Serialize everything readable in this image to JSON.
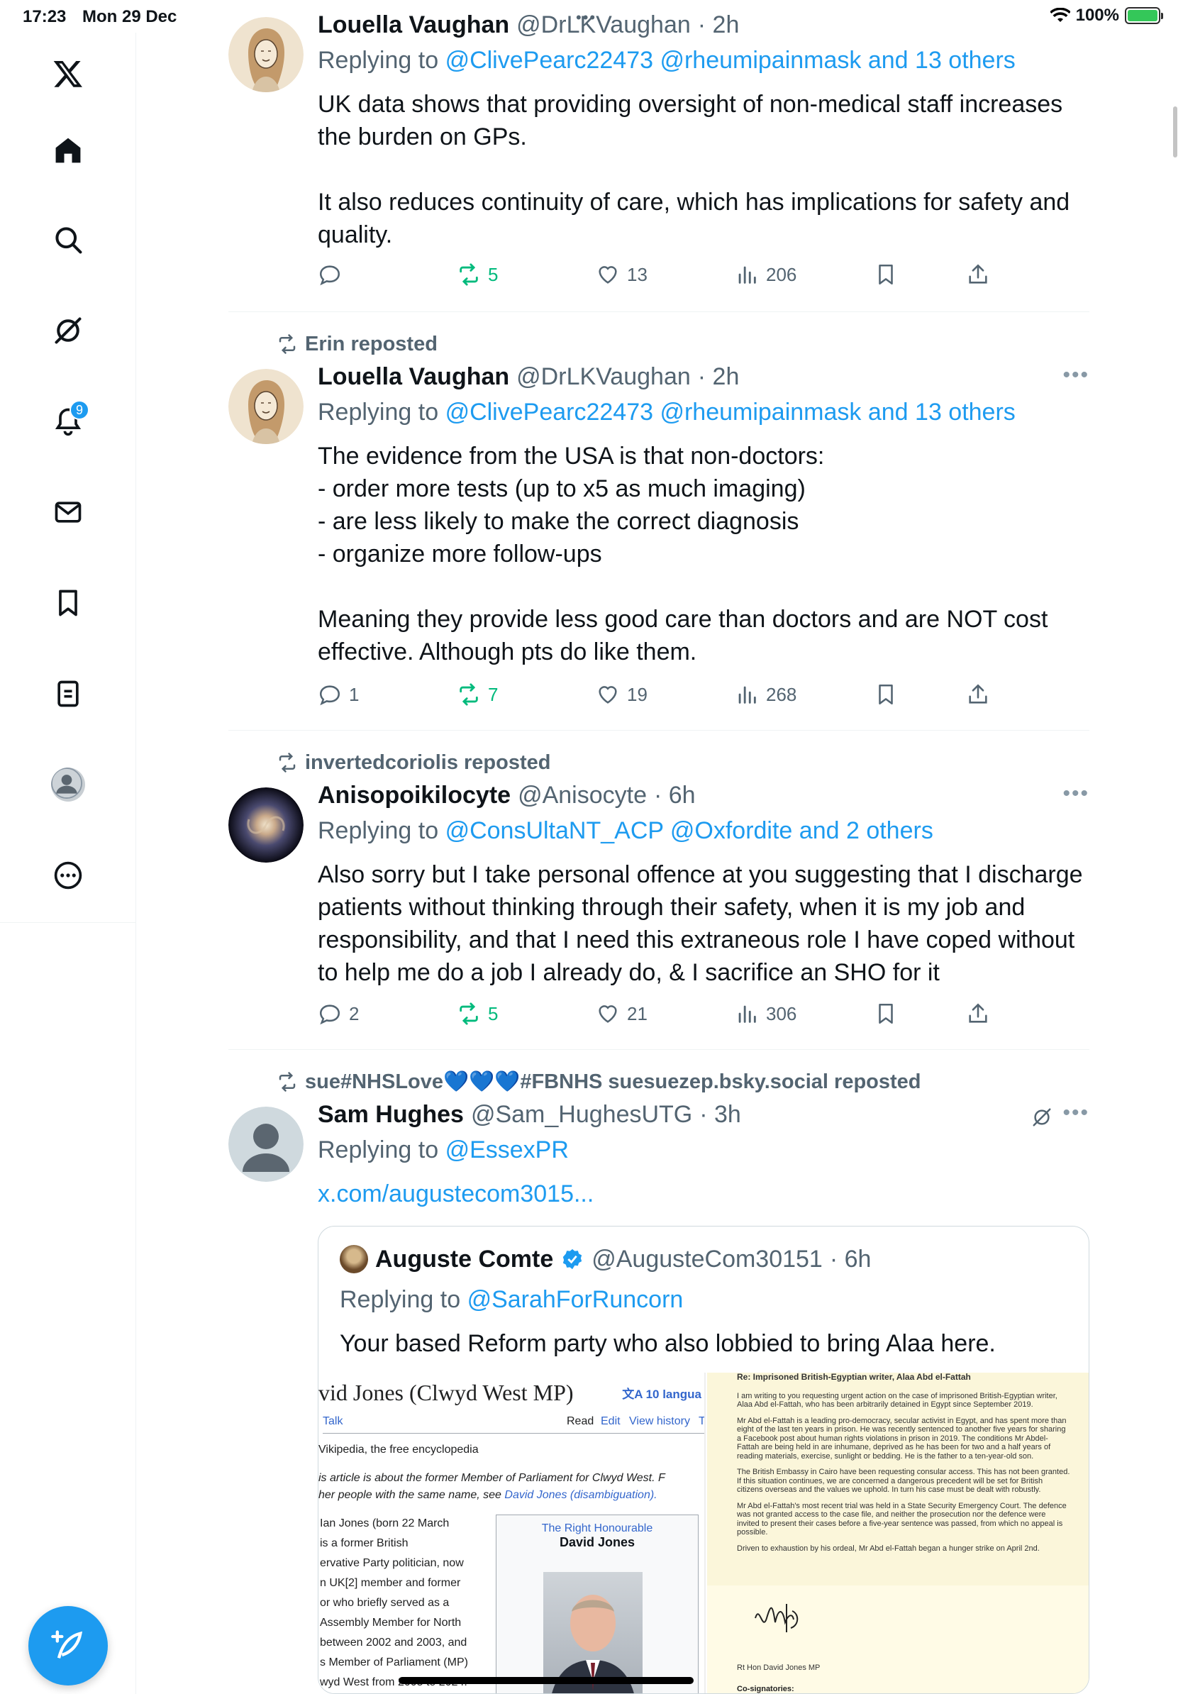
{
  "status": {
    "time": "17:23",
    "date": "Mon 29 Dec",
    "battery": "100%",
    "battery_level": 1.0
  },
  "sidebar": {
    "notifications_badge": "9",
    "items": [
      "x-logo-icon",
      "home-icon",
      "search-icon",
      "grok-icon",
      "notifications-icon",
      "messages-icon",
      "bookmarks-icon",
      "lists-icon",
      "profile-icon",
      "more-icon"
    ]
  },
  "tweets": [
    {
      "name": "Louella Vaughan",
      "handle": "@DrLKVaughan",
      "time": "· 2h",
      "replying_prefix": "Replying to",
      "replying_to": "@ClivePearc22473 @rheumipainmask and 13 others",
      "text": "UK data shows that providing oversight of non-medical staff increases\nthe burden on GPs.\n\nIt also reduces continuity of care, which has implications for safety and\nquality.",
      "replies": "",
      "reposts": "5",
      "likes": "13",
      "views": "206"
    },
    {
      "reposted_by": "Erin reposted",
      "name": "Louella Vaughan",
      "handle": "@DrLKVaughan",
      "time": "· 2h",
      "replying_prefix": "Replying to",
      "replying_to": "@ClivePearc22473 @rheumipainmask and 13 others",
      "text": "The evidence from the USA is that non-doctors:\n- order more tests (up to x5 as much imaging)\n- are less likely to make the correct diagnosis\n- organize more follow-ups\n\nMeaning they provide less good care than doctors and are NOT cost\neffective. Although pts do like them.",
      "replies": "1",
      "reposts": "7",
      "likes": "19",
      "views": "268"
    },
    {
      "reposted_by": "invertedcoriolis reposted",
      "name": "Anisopoikilocyte",
      "handle": "@Anisocyte",
      "time": "· 6h",
      "replying_prefix": "Replying to",
      "replying_to": "@ConsUltaNT_ACP @Oxfordite and 2 others",
      "text": "Also sorry but I take personal offence at you suggesting that I discharge\npatients without thinking through their safety, when it is my job and\nresponsibility, and that I need this extraneous role I have coped without\nto help me do a job I already do, & I sacrifice an SHO for it",
      "replies": "2",
      "reposts": "5",
      "likes": "21",
      "views": "306"
    },
    {
      "reposted_by": "sue#NHSLove💙💙💙#FBNHS suesuezep.bsky.social reposted",
      "name": "Sam Hughes",
      "handle": "@Sam_HughesUTG",
      "time": "· 3h",
      "replying_prefix": "Replying to",
      "replying_to": "@EssexPR",
      "link": "x.com/augustecom3015...",
      "quote": {
        "name": "Auguste Comte",
        "handle": "@AugusteCom30151",
        "time": "· 6h",
        "replying_prefix": "Replying to",
        "replying_to": "@SarahForRuncorn",
        "text": "Your based Reform party who also lobbied to bring Alaa here.",
        "wiki": {
          "title": "vid Jones (Clwyd West MP)",
          "languages": "10 langua",
          "tab_talk": "Talk",
          "tab_read": "Read",
          "tab_edit": "Edit",
          "tab_history": "View history",
          "tab_t": "T",
          "from": "Vikipedia, the free encyclopedia",
          "hatnote_1": "is article is about the former Member of Parliament for Clwyd West. F",
          "hatnote_2": "her people with the same name, see",
          "hatnote_link": "David Jones (disambiguation).",
          "lines": [
            "Ian Jones (born 22 March",
            "is a former British",
            "ervative Party politician, now",
            "n UK[2] member and former",
            "or who briefly served as a",
            "Assembly Member for North",
            "between 2002 and 2003, and",
            "s Member of Parliament (MP)",
            "wyd West from 2005 to 2024."
          ],
          "infobox_top": "The Right Honourable",
          "infobox_name": "David Jones"
        },
        "letter": {
          "heading": "Re: Imprisoned British-Egyptian writer, Alaa Abd el-Fattah",
          "p1": "I am writing to you requesting urgent action on the case of imprisoned British-Egyptian writer, Alaa Abd el-Fattah, who has been arbitrarily detained in Egypt since September 2019.",
          "p2": "Mr Abd el-Fattah is a leading pro-democracy, secular activist in Egypt, and has spent more than eight of the last ten years in prison. He was recently sentenced to another five years for sharing a Facebook post about human rights violations in prison in 2019. The conditions Mr Abdel-Fattah are being held in are inhumane, deprived as he has been for two and a half years of reading materials, exercise, sunlight or bedding. He is the father to a ten-year-old son.",
          "p3": "The British Embassy in Cairo have been requesting consular access. This has not been granted. If this situation continues, we are concerned a dangerous precedent will be set for British citizens overseas and the values we uphold. In turn his case must be dealt with robustly.",
          "p4": "Mr Abd el-Fattah's most recent trial was held in a State Security Emergency Court. The defence was not granted access to the case file, and neither the prosecution nor the defence were invited to present their cases before a five-year sentence was passed, from which no appeal is possible.",
          "p5": "Driven to exhaustion by his ordeal, Mr Abd el-Fattah began a hunger strike on April 2nd.",
          "signatory": "Rt Hon David Jones MP",
          "cosign": "Co-signatories:"
        }
      }
    }
  ]
}
